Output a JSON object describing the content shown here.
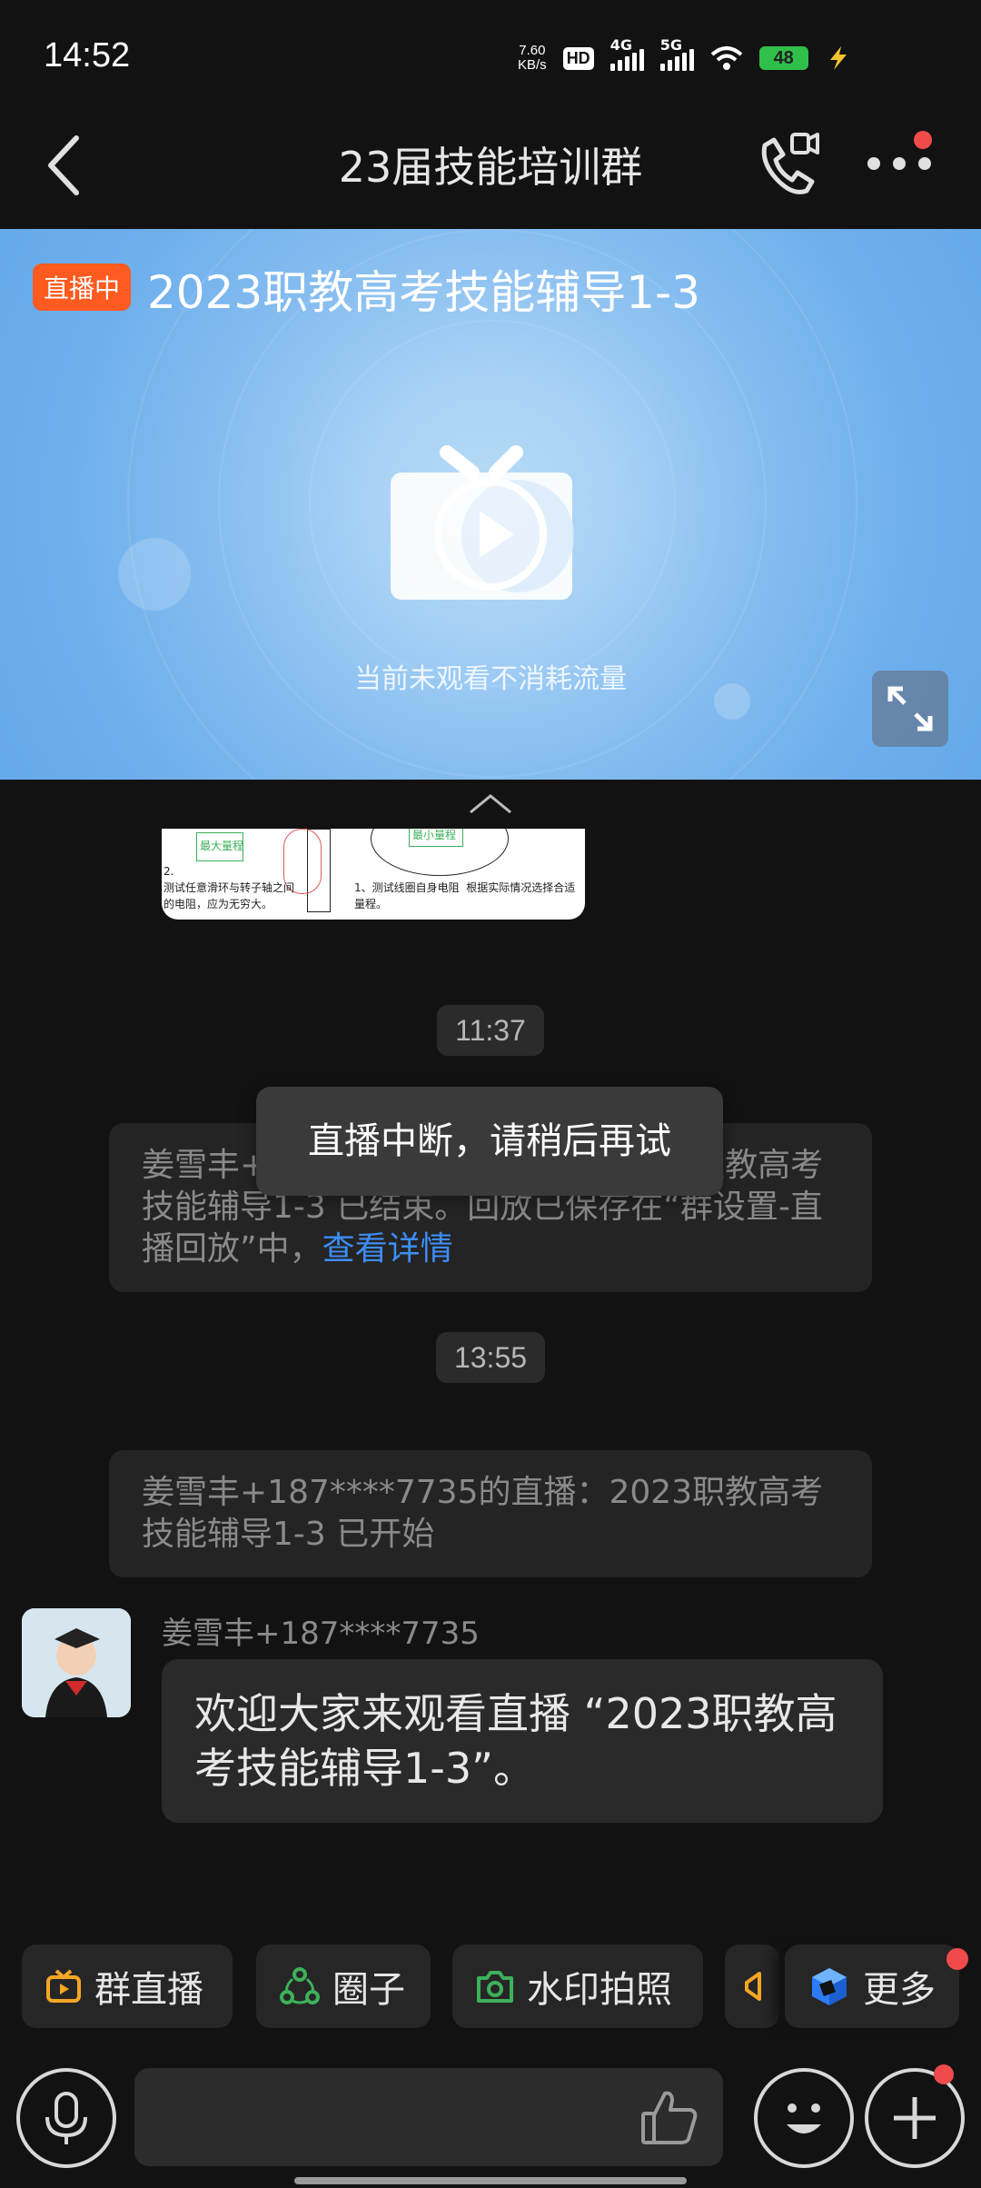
{
  "status_bar": {
    "time": "14:52",
    "net_speed_value": "7.60",
    "net_speed_unit": "KB/s",
    "hd_label": "HD",
    "signal_1": "4G",
    "signal_2": "5G",
    "battery_level": "48"
  },
  "header": {
    "title": "23届技能培训群"
  },
  "live": {
    "badge": "直播中",
    "title": "2023职教高考技能辅导1-3",
    "hint": "当前未观看不消耗流量"
  },
  "image_preview": {
    "label_max_range": "最大量程",
    "label_min_range": "最小量程",
    "note_left": "2.\n测试任意滑环与转子轴之间\n的电阻，应为无穷大。",
    "note_right": "1、测试线圈自身电阻  根据实际情况选择合适\n量程。"
  },
  "messages": {
    "time_1": "11:37",
    "system_1_text": "姜雪丰+187****7735的直播：2023职教高考技能辅导1-3 已结束。回放已保存在“群设置-直播回放”中，",
    "system_1_link": "查看详情",
    "time_2": "13:55",
    "system_2_text": "姜雪丰+187****7735的直播：2023职教高考技能辅导1-3 已开始",
    "sender_name": "姜雪丰+187****7735",
    "bubble_text": "欢迎大家来观看直播 “2023职教高考技能辅导1-3”。"
  },
  "toast": {
    "text": "直播中断，请稍后再试"
  },
  "quick_actions": {
    "group_live": "群直播",
    "circle": "圈子",
    "watermark_photo": "水印拍照",
    "more": "更多"
  },
  "colors": {
    "background": "#121212",
    "live_badge": "#ff5a1f",
    "link": "#3d8ef7",
    "notification_dot": "#f04b4b"
  }
}
